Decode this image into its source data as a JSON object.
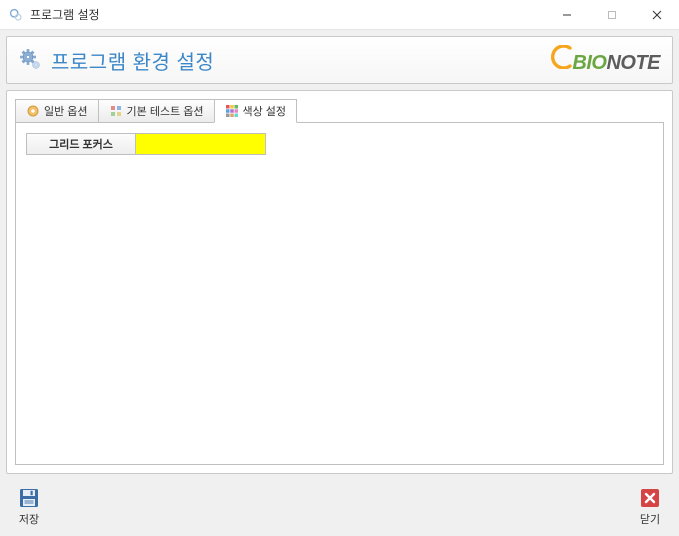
{
  "window": {
    "title": "프로그램 설정"
  },
  "header": {
    "title": "프로그램 환경 설정",
    "logo": {
      "bio": "BIO",
      "note": "NOTE"
    }
  },
  "tabs": {
    "general": {
      "label": "일반 옵션"
    },
    "basic_test": {
      "label": "기본 테스트 옵션"
    },
    "color": {
      "label": "색상 설정"
    }
  },
  "color_tab": {
    "grid_focus_label": "그리드 포커스",
    "grid_focus_color": "#ffff00"
  },
  "footer": {
    "save": "저장",
    "close": "닫기"
  }
}
